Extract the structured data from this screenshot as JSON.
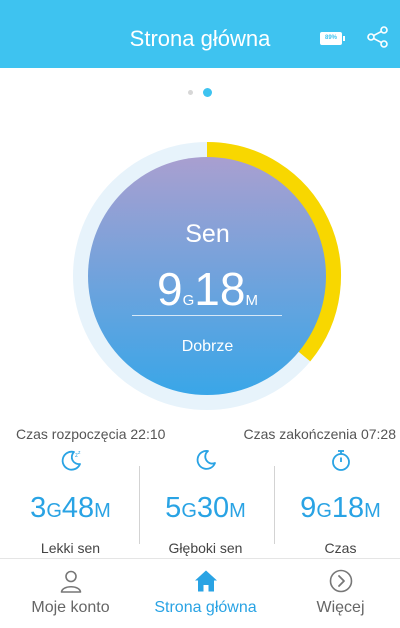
{
  "header": {
    "title": "Strona główna",
    "battery": "89%"
  },
  "pager": {
    "pages": 2,
    "active": 2
  },
  "sleep": {
    "title": "Sen",
    "hours": "9",
    "hours_unit": "G",
    "minutes": "18",
    "minutes_unit": "M",
    "quality": "Dobrze",
    "ring_progress": 0.36,
    "colors": {
      "ring_fill": "#f8d700",
      "ring_track": "#e7f3fb",
      "circle_top": "#a99fd0",
      "circle_bottom": "#39a6e8"
    }
  },
  "times": {
    "start": "Czas rozpoczęcia 22:10",
    "end": "Czas zakończenia 07:28"
  },
  "stats": [
    {
      "icon": "light-sleep-icon",
      "hours": "3",
      "minutes": "48",
      "label": "Lekki sen"
    },
    {
      "icon": "deep-sleep-icon",
      "hours": "5",
      "minutes": "30",
      "label": "Głęboki sen"
    },
    {
      "icon": "stopwatch-icon",
      "hours": "9",
      "minutes": "18",
      "label": "Czas"
    }
  ],
  "units": {
    "hours": "G",
    "minutes": "M"
  },
  "nav": [
    {
      "icon": "person-icon",
      "label": "Moje konto",
      "active": false
    },
    {
      "icon": "home-icon",
      "label": "Strona główna",
      "active": true
    },
    {
      "icon": "chevron-right-circle-icon",
      "label": "Więcej",
      "active": false
    }
  ],
  "accent_color": "#3ec3f0"
}
